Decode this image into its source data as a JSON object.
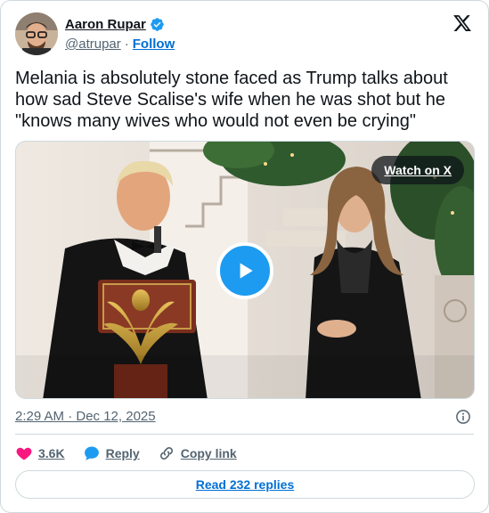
{
  "author": {
    "name": "Aaron Rupar",
    "handle": "@atrupar",
    "separator": "·",
    "follow_label": "Follow",
    "verified": true
  },
  "tweet": {
    "text": "Melania is absolutely stone faced as Trump talks about how sad Steve Scalise's wife when he was shot but he \"knows many wives who would not even be crying\""
  },
  "media": {
    "watch_label": "Watch on X",
    "play_icon": "play-icon"
  },
  "meta": {
    "timestamp": "2:29 AM · Dec 12, 2025",
    "info_icon": "info-icon"
  },
  "actions": {
    "like_count": "3.6K",
    "reply_label": "Reply",
    "copy_label": "Copy link"
  },
  "replies_button": "Read 232 replies",
  "colors": {
    "accent": "#1d9bf0",
    "link": "#006fd6",
    "like": "#f91880",
    "muted": "#536471"
  }
}
